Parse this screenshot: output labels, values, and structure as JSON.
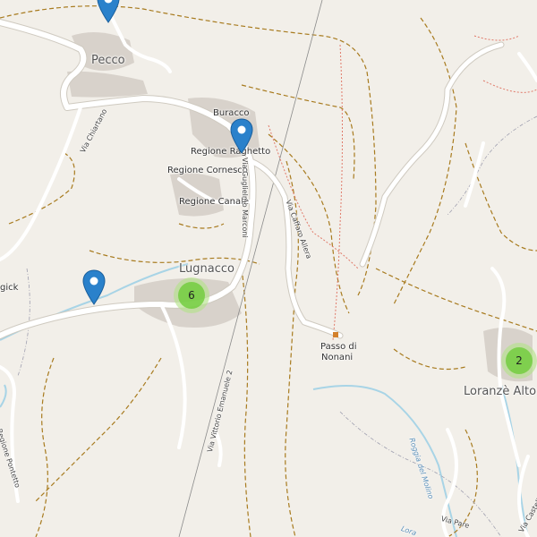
{
  "places": {
    "pecco": "Pecco",
    "buracco": "Buracco",
    "regione_raghetto": "Regione Raghetto",
    "regione_cornesco": "Regione Cornesco",
    "regione_canale": "Regione Canale",
    "lugnacco": "Lugnacco",
    "passo_line1": "Passo di",
    "passo_line2": "Nonani",
    "loranze_alto": "Loranzè Alto",
    "gick": "gick"
  },
  "roads": {
    "chiartano": "Via Chiartano",
    "marconi": "Via Guglielmo Marconi",
    "caffaro": "Via Caffaro Allera",
    "vittorio": "Via Vittorio Emanuele 2",
    "pontetto": "Regione Pontetto",
    "castello": "Via Castello",
    "pare": "Via Pare"
  },
  "water": {
    "roggia": "Roggia del Molino",
    "lora": "Lora"
  },
  "clusters": [
    {
      "count": "6"
    },
    {
      "count": "2"
    }
  ],
  "colors": {
    "land": "#f2efe9",
    "road": "#ffffff",
    "road_casing": "#cfcac0",
    "track": "#a87b1f",
    "path": "#e07a6a",
    "water": "#a8d4e6",
    "building": "#d8d2cb",
    "marker": "#2a81cb",
    "cluster_outer": "#b5e28c",
    "cluster_inner": "#6ecc39"
  }
}
